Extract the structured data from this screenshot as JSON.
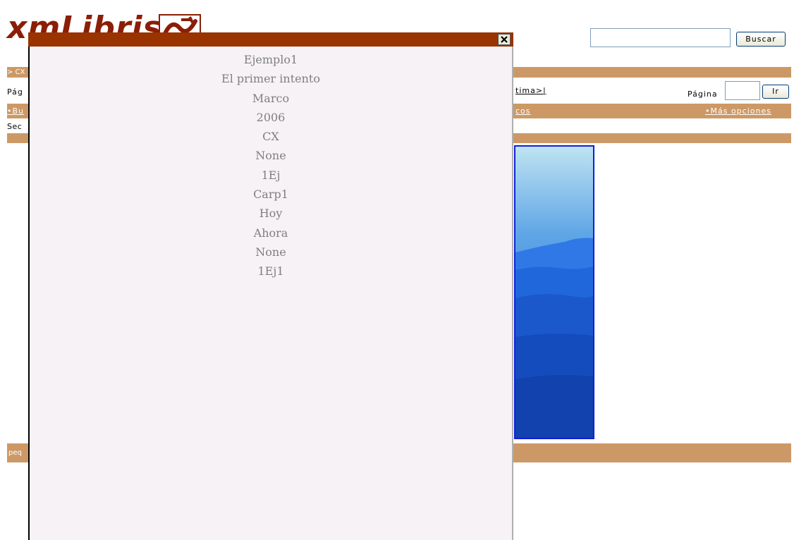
{
  "page": {
    "logo_text": "xmLibris",
    "search": {
      "button_label": "Buscar",
      "value": "",
      "placeholder": ""
    },
    "breadcrumb": "> CX",
    "paging": {
      "prefix": "Pág",
      "last_label": "tima>|",
      "page_label": "Página",
      "page_value": "",
      "go_label": "Ir"
    },
    "nav": {
      "left_label": "•Bu",
      "mid_label": "cos",
      "more_label": "•Más opciones"
    },
    "section_label": "Sec",
    "footer_label": "peq"
  },
  "popup": {
    "close_icon": "close-icon",
    "fields": [
      "Ejemplo1",
      "El primer intento",
      "Marco",
      "2006",
      "CX",
      "None",
      "1Ej",
      "Carp1",
      "Hoy",
      "Ahora",
      "None",
      "1Ej1"
    ]
  },
  "colors": {
    "band": "#cc9966",
    "popup_titlebar": "#993300",
    "logo": "#8b1e06",
    "popup_body": "#f6f2f6"
  }
}
